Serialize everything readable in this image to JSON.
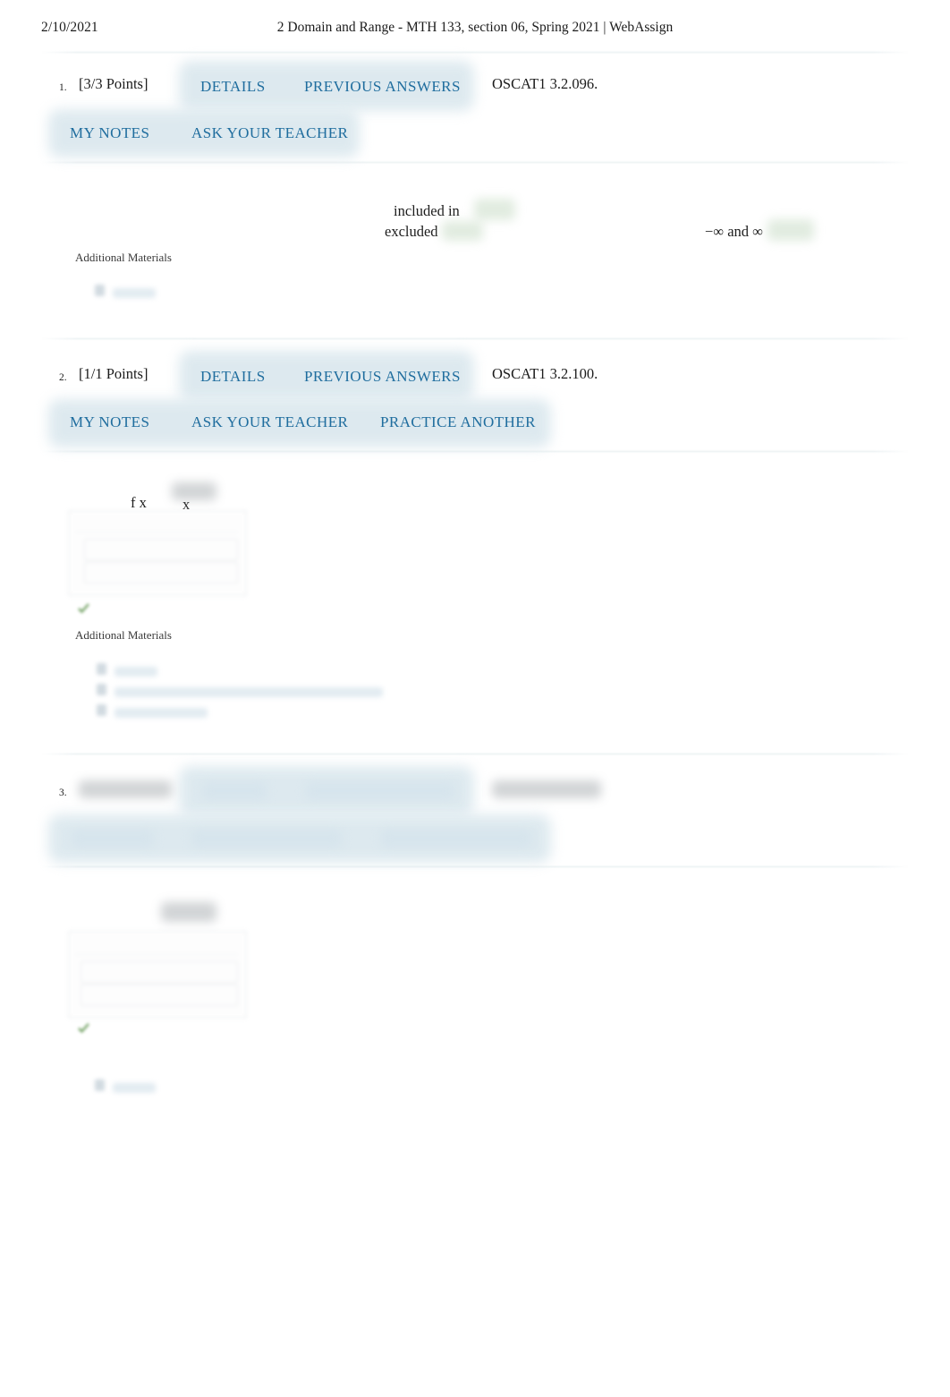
{
  "header": {
    "date": "2/10/2021",
    "title": "2 Domain and Range - MTH 133, section 06, Spring 2021 | WebAssign"
  },
  "colors": {
    "link_blue": "#1f6d9e",
    "button_glow": "#dbe8ee",
    "text": "#1c1c1c",
    "rule": "#dde7eb",
    "check_green": "#4f8a3d"
  },
  "labels": {
    "additional_materials": "Additional Materials"
  },
  "problems": [
    {
      "number": "1.",
      "points": "[3/3 Points]",
      "code": "OSCAT1 3.2.096.",
      "buttons_row1": [
        "DETAILS",
        "PREVIOUS ANSWERS"
      ],
      "buttons_row2": [
        "MY NOTES",
        "ASK YOUR TEACHER"
      ],
      "body_text": [
        "included in",
        "excluded",
        "−∞ and ∞"
      ]
    },
    {
      "number": "2.",
      "points": "[1/1 Points]",
      "code": "OSCAT1 3.2.100.",
      "buttons_row1": [
        "DETAILS",
        "PREVIOUS ANSWERS"
      ],
      "buttons_row2": [
        "MY NOTES",
        "ASK YOUR TEACHER",
        "PRACTICE ANOTHER"
      ],
      "body_text": [
        "f x",
        "x"
      ]
    },
    {
      "number": "3.",
      "points": "",
      "code": "",
      "buttons_row1": [
        "",
        ""
      ],
      "buttons_row2": [
        "",
        "",
        ""
      ],
      "body_text": []
    }
  ]
}
